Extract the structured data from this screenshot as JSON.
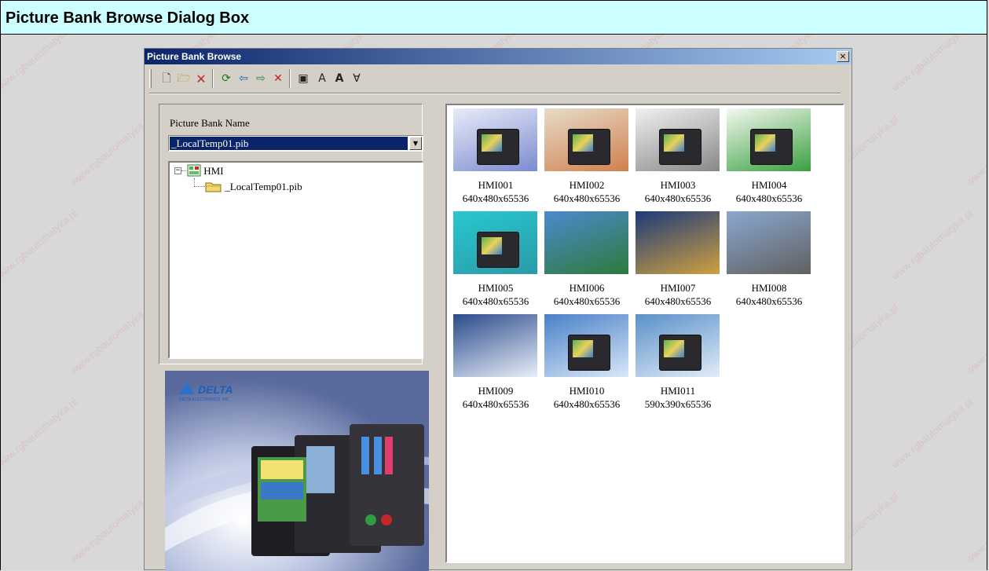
{
  "header": {
    "title": "Picture Bank Browse Dialog Box"
  },
  "watermark_text": "www.rgbautomatyka.pl",
  "dialog": {
    "title": "Picture Bank Browse",
    "close_glyph": "×",
    "toolbar": [
      {
        "name": "new-bank-icon",
        "glyph": "🗋"
      },
      {
        "name": "open-bank-icon",
        "glyph": "🗁"
      },
      {
        "name": "delete-bank-icon",
        "glyph": "🗙"
      },
      {
        "name": "refresh-icon",
        "glyph": "⟳"
      },
      {
        "name": "import-icon",
        "glyph": "⇦"
      },
      {
        "name": "export-icon",
        "glyph": "⇨"
      },
      {
        "name": "delete-picture-icon",
        "glyph": "✕"
      },
      {
        "name": "picture-icon",
        "glyph": "▣"
      },
      {
        "name": "font-icon",
        "glyph": "A"
      },
      {
        "name": "font-bold-icon",
        "glyph": "A"
      },
      {
        "name": "font-down-icon",
        "glyph": "∀"
      }
    ],
    "bank_name_label": "Picture Bank Name",
    "bank_name_value": "_LocalTemp01.pib",
    "tree": {
      "root": "HMI",
      "child": "_LocalTemp01.pib",
      "root_expander": "−"
    },
    "pictures": [
      {
        "name": "HMI001",
        "size": "640x480x65536"
      },
      {
        "name": "HMI002",
        "size": "640x480x65536"
      },
      {
        "name": "HMI003",
        "size": "640x480x65536"
      },
      {
        "name": "HMI004",
        "size": "640x480x65536"
      },
      {
        "name": "HMI005",
        "size": "640x480x65536"
      },
      {
        "name": "HMI006",
        "size": "640x480x65536"
      },
      {
        "name": "HMI007",
        "size": "640x480x65536"
      },
      {
        "name": "HMI008",
        "size": "640x480x65536"
      },
      {
        "name": "HMI009",
        "size": "640x480x65536"
      },
      {
        "name": "HMI010",
        "size": "640x480x65536"
      },
      {
        "name": "HMI011",
        "size": "590x390x65536"
      }
    ],
    "preview": {
      "brand": "DELTA",
      "tagline": "DELTA ELECTRONICS, INC."
    }
  },
  "colors": {
    "header_bg": "#ccffff",
    "titlebar_start": "#0a246a",
    "titlebar_end": "#a6caf0",
    "dialog_bg": "#d4d0c8",
    "selection": "#0a246a"
  }
}
